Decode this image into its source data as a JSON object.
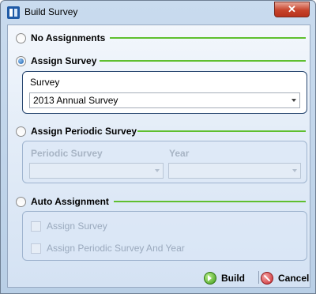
{
  "window": {
    "title": "Build Survey",
    "close_glyph": "✕"
  },
  "options": {
    "no_assignments": "No Assignments",
    "assign_survey": "Assign Survey",
    "assign_periodic_survey": "Assign Periodic Survey",
    "auto_assignment": "Auto Assignment"
  },
  "assign_survey_group": {
    "label": "Survey",
    "value": "2013 Annual Survey"
  },
  "periodic_group": {
    "periodic_label": "Periodic Survey",
    "year_label": "Year",
    "periodic_value": "",
    "year_value": ""
  },
  "auto_group": {
    "assign_survey": "Assign Survey",
    "assign_periodic": "Assign Periodic Survey And Year"
  },
  "buttons": {
    "build": "Build",
    "cancel": "Cancel"
  },
  "colors": {
    "accent_line": "#5fbf2f",
    "active_border": "#27466f"
  }
}
